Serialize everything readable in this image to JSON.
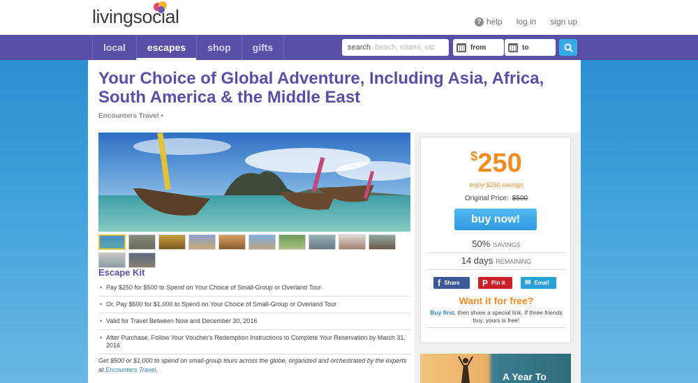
{
  "header": {
    "logo": "livingsocial",
    "links": {
      "help": "help",
      "login": "log in",
      "signup": "sign up"
    }
  },
  "nav": {
    "tabs": [
      "local",
      "escapes",
      "shop",
      "gifts"
    ],
    "active": "escapes",
    "search_label": "search",
    "search_placeholder": "beach, miami, etc",
    "from_label": "from",
    "to_label": "to"
  },
  "deal": {
    "title": "Your Choice of Global Adventure, Including Asia, Africa, South America & the Middle East",
    "merchant": "Encounters Travel •",
    "kit_title": "Escape Kit",
    "kit_items": [
      "Pay $250 for $500 to Spend on Your Choice of Small-Group or Overland Tour",
      "Or, Pay $500 for $1,000 to Spend on Your Choice of Small-Group or Overland Tour",
      "Valid for Travel Between Now and December 30, 2016",
      "After Purchase, Follow Your Voucher's Redemption Instructions to Complete Your Reservation by March 31, 2016"
    ],
    "description": "Get $500 or $1,000 to spend on small-group tours across the globe, organized and orchestrated by the experts at ",
    "description_link": "Encounters Travel",
    "description_end": "."
  },
  "buybox": {
    "currency": "$",
    "price": "250",
    "enjoy": "enjoy $250 savings",
    "original_label": "Original Price:",
    "original_value": "$500",
    "buy_label": "buy now!",
    "savings_value": "50%",
    "savings_label": "SAVINGS",
    "days_value": "14 days",
    "days_label": "REMAINING",
    "share_facebook": "Share",
    "share_pinterest": "Pin it",
    "share_email": "Email",
    "want_free": "Want it for free?",
    "free_link": "Buy first",
    "free_text": ", then share a special link. If three friends buy, yours is free!"
  },
  "promo": {
    "text": "A Year To"
  },
  "colors": {
    "brand": "#5a4fa7",
    "accent": "#f38b23",
    "button": "#3aa9e8"
  }
}
